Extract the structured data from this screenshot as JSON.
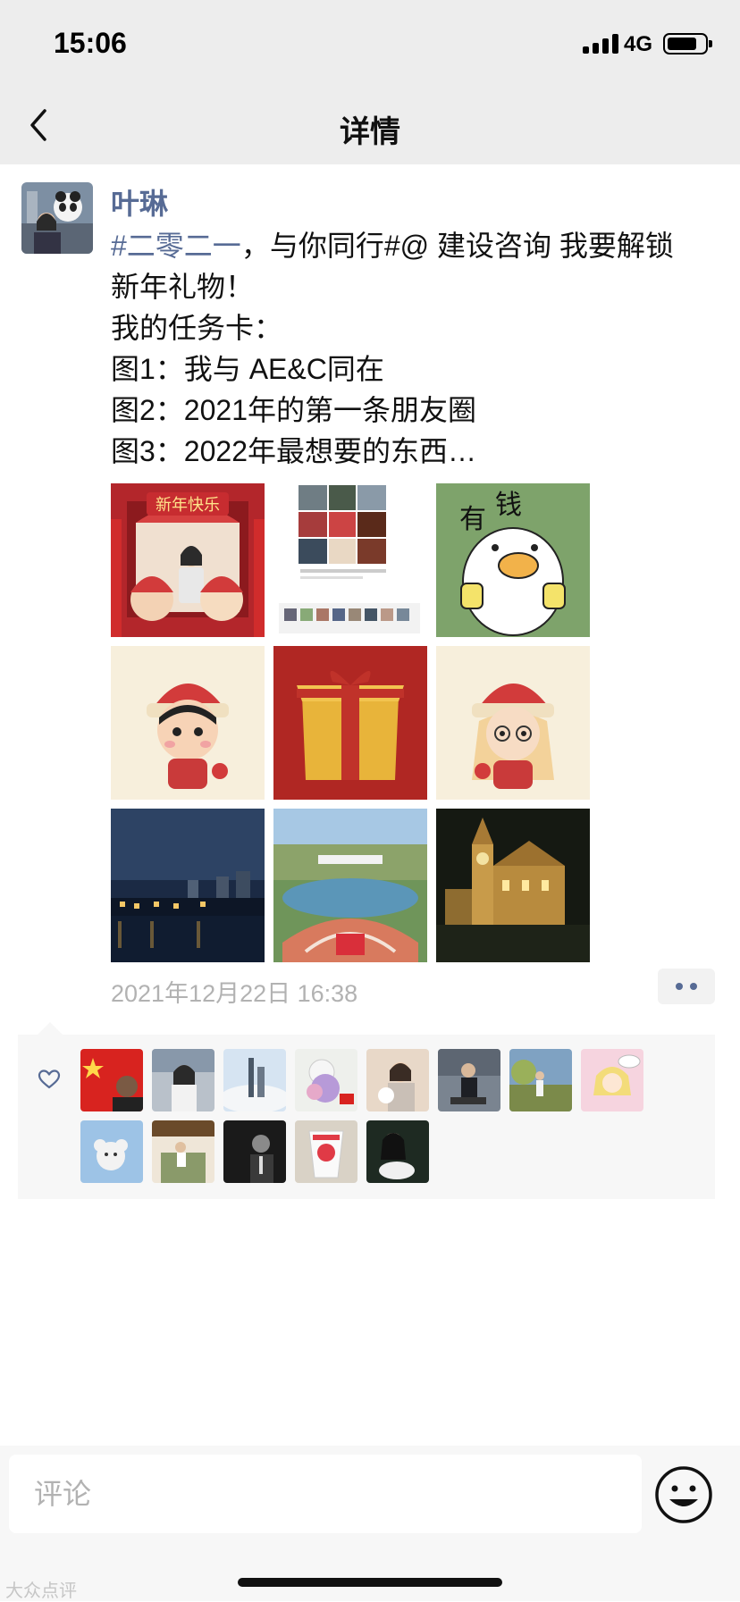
{
  "status_bar": {
    "time": "15:06",
    "network": "4G",
    "battery_level": 0.8
  },
  "nav": {
    "title": "详情"
  },
  "post": {
    "author": "叶琳",
    "text_lines": [
      {
        "tag": "#二零二一",
        "rest": "，与你同行#@ 建设咨询 我要解锁"
      },
      {
        "tag": "",
        "rest": "新年礼物！"
      },
      {
        "tag": "",
        "rest": "我的任务卡："
      },
      {
        "tag": "",
        "rest": "图1：我与 AE&C同在"
      },
      {
        "tag": "",
        "rest": "图2：2021年的第一条朋友圈"
      },
      {
        "tag": "",
        "rest": "图3：2022年最想要的东西…"
      }
    ],
    "photos": [
      "photo-new-year-booth",
      "photo-moments-collage",
      "photo-rich-duck-sticker",
      "photo-lion-boy-cartoon",
      "photo-gift-box",
      "photo-lion-girl-cartoon",
      "photo-night-skyline",
      "photo-aerial-park",
      "photo-night-castle"
    ],
    "photo_overlay": {
      "photo_1_text": "新年快乐",
      "photo_3_text_left": "有",
      "photo_3_text_right": "钱"
    },
    "timestamp": "2021年12月22日 16:38"
  },
  "likes": {
    "avatars": [
      "liker-1",
      "liker-2",
      "liker-3",
      "liker-4",
      "liker-5",
      "liker-6",
      "liker-7",
      "liker-8",
      "liker-9",
      "liker-10",
      "liker-11",
      "liker-12",
      "liker-13"
    ]
  },
  "comment_bar": {
    "placeholder": "评论"
  },
  "watermark": "大众点评"
}
